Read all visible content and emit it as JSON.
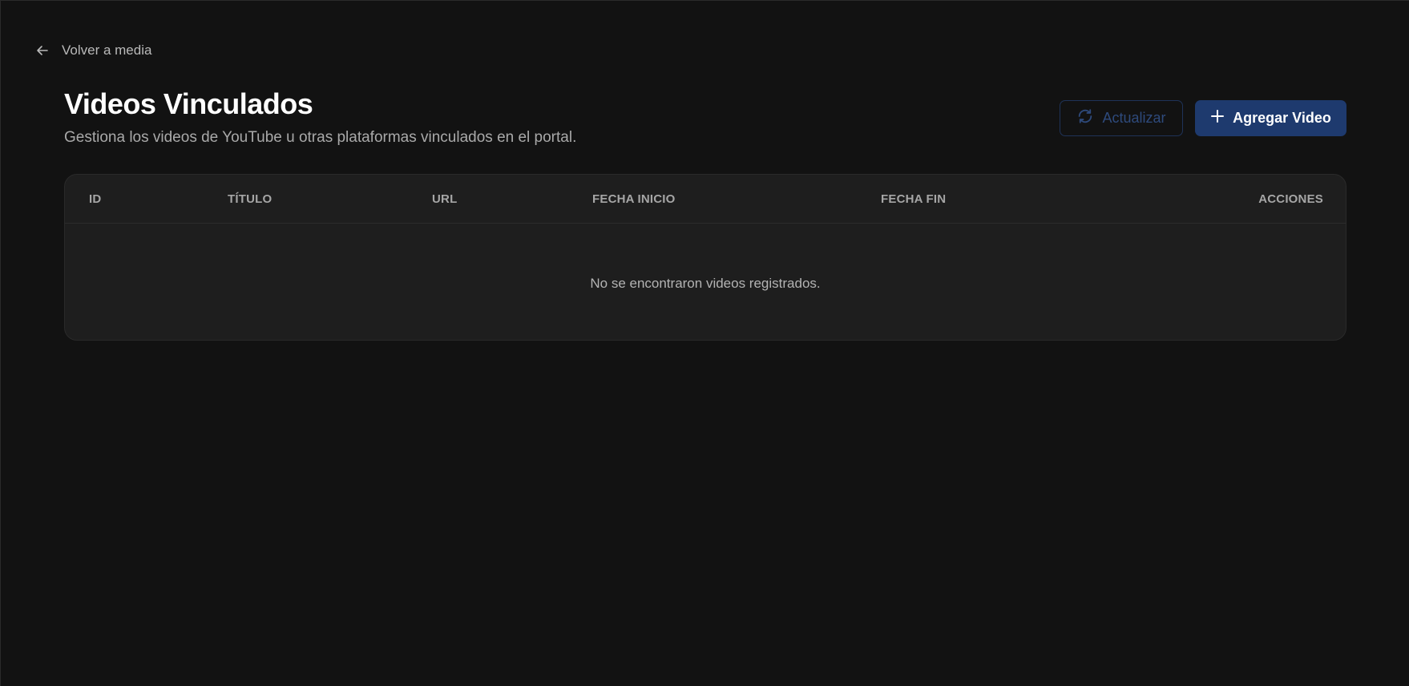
{
  "nav": {
    "back_label": "Volver a media",
    "back_icon": "arrow-left-icon"
  },
  "header": {
    "title": "Videos Vinculados",
    "subtitle": "Gestiona los videos de YouTube u otras plataformas vinculados en el portal."
  },
  "toolbar": {
    "refresh_label": "Actualizar",
    "refresh_icon": "refresh-icon",
    "add_label": "Agregar Video",
    "add_icon": "plus-icon"
  },
  "table": {
    "columns": [
      "ID",
      "TÍTULO",
      "URL",
      "FECHA INICIO",
      "FECHA FIN",
      "ACCIONES"
    ],
    "rows": [],
    "empty_message": "No se encontraron videos registrados."
  },
  "colors": {
    "background": "#121212",
    "card": "#1e1e1e",
    "accent": "#1e3a6e",
    "refresh_disabled": "#2e4a7c"
  }
}
